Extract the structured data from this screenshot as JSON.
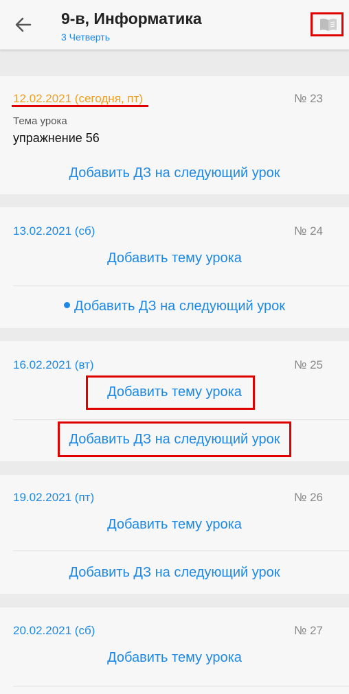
{
  "header": {
    "title": "9-в, Информатика",
    "subtitle": "3 Четверть",
    "back_icon": "arrow-left-icon",
    "book_icon": "book-icon"
  },
  "lessons": [
    {
      "date": "12.02.2021 (сегодня, пт)",
      "number": "№ 23",
      "topic_label": "Тема урока",
      "topic_value": "упражнение 56",
      "add_hw": "Добавить ДЗ на следующий урок"
    },
    {
      "date": "13.02.2021 (сб)",
      "number": "№ 24",
      "add_topic": "Добавить тему урока",
      "add_hw": "Добавить ДЗ на следующий урок"
    },
    {
      "date": "16.02.2021 (вт)",
      "number": "№ 25",
      "add_topic": "Добавить тему урока",
      "add_hw": "Добавить ДЗ на следующий урок"
    },
    {
      "date": "19.02.2021 (пт)",
      "number": "№ 26",
      "add_topic": "Добавить тему урока",
      "add_hw": "Добавить ДЗ на следующий урок"
    },
    {
      "date": "20.02.2021 (сб)",
      "number": "№ 27",
      "add_topic": "Добавить тему урока"
    }
  ],
  "colors": {
    "accent": "#1e88e5",
    "today": "#f0a020",
    "highlight": "#e00000"
  }
}
